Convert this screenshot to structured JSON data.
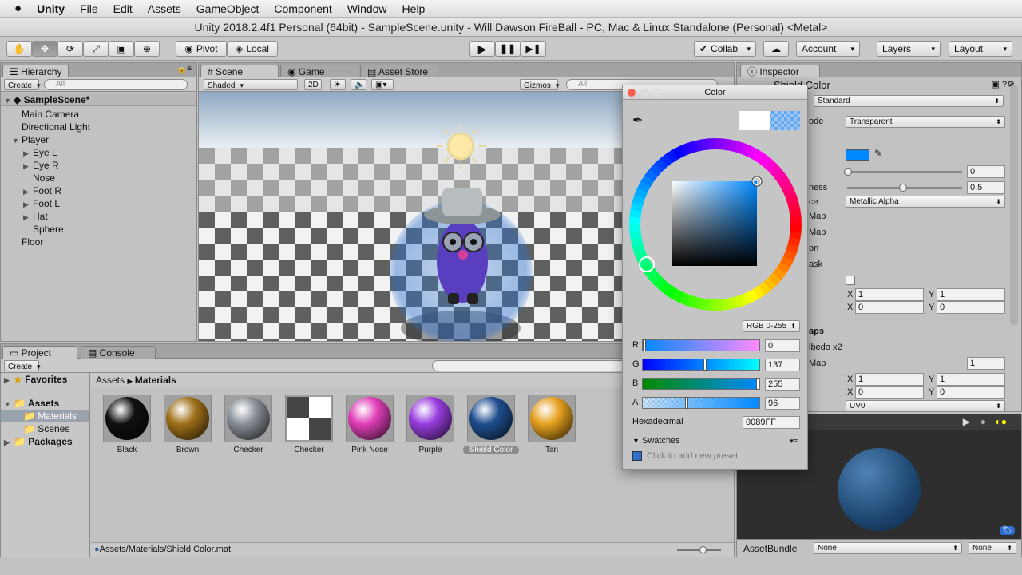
{
  "menubar": {
    "apple": "",
    "app": "Unity",
    "items": [
      "File",
      "Edit",
      "Assets",
      "GameObject",
      "Component",
      "Window",
      "Help"
    ]
  },
  "window_title": "Unity 2018.2.4f1 Personal (64bit) - SampleScene.unity - Will Dawson FireBall - PC, Mac & Linux Standalone (Personal) <Metal>",
  "toolbar": {
    "pivot": "Pivot",
    "local": "Local",
    "collab": "Collab",
    "account": "Account",
    "layers": "Layers",
    "layout": "Layout"
  },
  "hierarchy": {
    "tab": "Hierarchy",
    "create": "Create",
    "search_placeholder": "All",
    "scene": "SampleScene*",
    "items": [
      {
        "label": "Main Camera",
        "depth": 1,
        "arrow": ""
      },
      {
        "label": "Directional Light",
        "depth": 1,
        "arrow": ""
      },
      {
        "label": "Player",
        "depth": 1,
        "arrow": "▼"
      },
      {
        "label": "Eye L",
        "depth": 2,
        "arrow": "▶"
      },
      {
        "label": "Eye R",
        "depth": 2,
        "arrow": "▶"
      },
      {
        "label": "Nose",
        "depth": 2,
        "arrow": ""
      },
      {
        "label": "Foot R",
        "depth": 2,
        "arrow": "▶"
      },
      {
        "label": "Foot L",
        "depth": 2,
        "arrow": "▶"
      },
      {
        "label": "Hat",
        "depth": 2,
        "arrow": "▶"
      },
      {
        "label": "Sphere",
        "depth": 2,
        "arrow": ""
      },
      {
        "label": "Floor",
        "depth": 1,
        "arrow": ""
      }
    ]
  },
  "scene": {
    "tabs": [
      "Scene",
      "Game",
      "Asset Store"
    ],
    "shading": "Shaded",
    "mode2d": "2D",
    "gizmos": "Gizmos",
    "search_placeholder": "All"
  },
  "inspector": {
    "tab": "Inspector",
    "object": "Shield Color",
    "shader": "Standard",
    "rows": [
      "ode",
      "ness",
      "ce",
      "Map",
      "Map",
      "on",
      "ask",
      "aps",
      "lbedo x2",
      "Map"
    ],
    "rendering_mode": "Transparent",
    "metallic_val": "0",
    "smoothness_val": "0.5",
    "source": "Metallic Alpha",
    "tiling1": {
      "x": "1",
      "y": "1"
    },
    "offset1": {
      "x": "0",
      "y": "0"
    },
    "detail_val": "1",
    "tiling2": {
      "x": "1",
      "y": "1"
    },
    "offset2": {
      "x": "0",
      "y": "0"
    },
    "uv": "UV0",
    "preview_label": "AssetBundle",
    "bundle1": "None",
    "bundle2": "None",
    "x": "X",
    "y": "Y"
  },
  "color_picker": {
    "title": "Color",
    "mode": "RGB 0-255",
    "r": {
      "label": "R",
      "value": "0"
    },
    "g": {
      "label": "G",
      "value": "137"
    },
    "b": {
      "label": "B",
      "value": "255"
    },
    "a": {
      "label": "A",
      "value": "96"
    },
    "levels": {
      "r": 0,
      "g": 0.537,
      "b": 1.0,
      "a": 0.376
    },
    "hex_label": "Hexadecimal",
    "hex": "0089FF",
    "swatches": "Swatches",
    "preset": "Click to add new preset",
    "color": "#0089FF"
  },
  "project": {
    "tabs": [
      "Project",
      "Console"
    ],
    "create": "Create",
    "breadcrumb": [
      "Assets",
      "Materials"
    ],
    "favorites": "Favorites",
    "assets": "Assets",
    "folders": [
      "Materials",
      "Scenes"
    ],
    "packages": "Packages",
    "materials": [
      {
        "name": "Black",
        "color": "#111111"
      },
      {
        "name": "Brown",
        "color": "#a0701a"
      },
      {
        "name": "Checker",
        "color": "#8a9098"
      },
      {
        "name": "Checker",
        "color": "checker"
      },
      {
        "name": "Pink Nose",
        "color": "#e03fb9"
      },
      {
        "name": "Purple",
        "color": "#9a3ee0"
      },
      {
        "name": "Shield Color",
        "color": "#1f4f90"
      },
      {
        "name": "Tan",
        "color": "#e6a11f"
      }
    ],
    "path": "Assets/Materials/Shield Color.mat"
  }
}
